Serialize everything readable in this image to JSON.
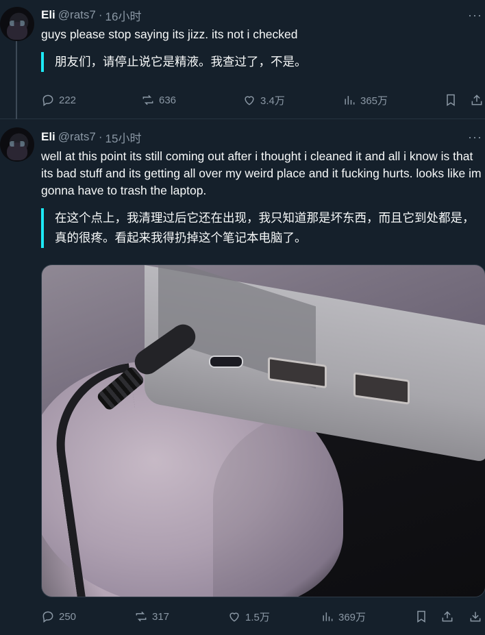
{
  "tweets": [
    {
      "name": "Eli",
      "handle": "@rats7",
      "separator": "·",
      "time": "16小时",
      "more": "···",
      "text": "guys please stop saying its jizz. its not i checked",
      "translation": "朋友们，请停止说它是精液。我查过了，不是。",
      "actions": {
        "replies": "222",
        "reposts": "636",
        "likes": "3.4万",
        "views": "365万"
      }
    },
    {
      "name": "Eli",
      "handle": "@rats7",
      "separator": "·",
      "time": "15小时",
      "more": "···",
      "text": "well at this point its still coming out after i thought i cleaned it and all i know is that its bad stuff and its getting all over my weird place and it fucking hurts. looks like im gonna have to trash the laptop.",
      "translation": "在这个点上，我清理过后它还在出现，我只知道那是坏东西，而且它到处都是，真的很疼。看起来我得扔掉这个笔记本电脑了。",
      "actions": {
        "replies": "250",
        "reposts": "317",
        "likes": "1.5万",
        "views": "369万"
      }
    }
  ],
  "icons": {
    "reply": "reply-icon",
    "repost": "repost-icon",
    "like": "heart-icon",
    "views": "views-icon",
    "bookmark": "bookmark-icon",
    "share": "share-icon",
    "download": "download-icon"
  },
  "colors": {
    "background": "#15202b",
    "text": "#f7f9f9",
    "muted": "#8b98a5",
    "translation_bar": "#1de9f5"
  }
}
